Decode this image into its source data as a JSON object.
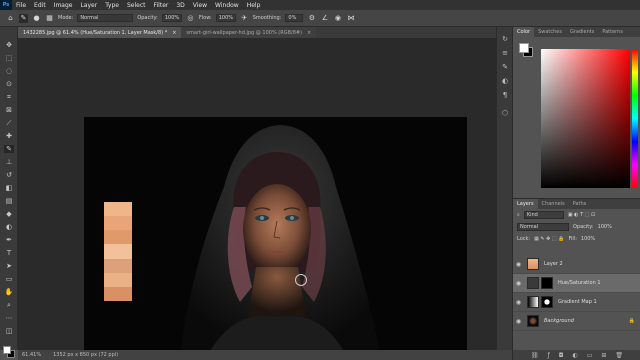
{
  "menubar": {
    "logo": "Ps",
    "items": [
      "File",
      "Edit",
      "Image",
      "Layer",
      "Type",
      "Select",
      "Filter",
      "3D",
      "View",
      "Window",
      "Help"
    ]
  },
  "options": {
    "mode_label": "Mode:",
    "mode_value": "Normal",
    "opacity_label": "Opacity:",
    "opacity_value": "100%",
    "flow_label": "Flow:",
    "flow_value": "100%",
    "smoothing_label": "Smoothing:",
    "smoothing_value": "0%"
  },
  "tabs": [
    {
      "label": "1432285.jpg @ 61.4% (Hue/Saturation 1, Layer Mask/8) *",
      "close": "×"
    },
    {
      "label": "smart-girl-wallpaper-hd.jpg @ 100% (RGB/8#)",
      "close": "×"
    }
  ],
  "status": {
    "zoom": "61.41%",
    "size": "1352 px x 850 px (72 ppi)"
  },
  "color_panel": {
    "tabs": [
      "Color",
      "Swatches",
      "Gradients",
      "Patterns"
    ]
  },
  "layers_panel": {
    "tabs": [
      "Layers",
      "Channels",
      "Paths"
    ],
    "kind_label": "Kind",
    "blend_mode": "Normal",
    "opacity_label": "Opacity:",
    "opacity_value": "100%",
    "lock_label": "Lock:",
    "fill_label": "Fill:",
    "fill_value": "100%",
    "layers": [
      {
        "name": "Layer 2"
      },
      {
        "name": "Hue/Saturation 1"
      },
      {
        "name": "Gradient Map 1"
      },
      {
        "name": "Background"
      }
    ],
    "footer_icons": [
      "link-icon",
      "fx-icon",
      "mask-icon",
      "adjustment-icon",
      "group-icon",
      "new-layer-icon",
      "trash-icon"
    ]
  },
  "colors": {
    "accent": "#31a8ff",
    "swatches": [
      "#f0b68a",
      "#e9a578",
      "#e09a6a",
      "#f2c09a",
      "#dca07a",
      "#eab187",
      "#d99063"
    ]
  }
}
